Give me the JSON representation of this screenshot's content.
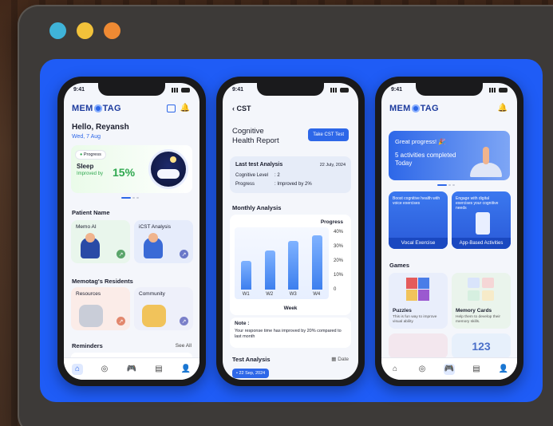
{
  "window": {
    "dots": [
      "#3fb3d8",
      "#f2c23a",
      "#ef8a33"
    ]
  },
  "phone1": {
    "time": "9:41",
    "logo_left": "MEM",
    "logo_right": "TAG",
    "greeting": "Hello, Reyansh",
    "date": "Wed, 7 Aug",
    "progress_tag": "Progress",
    "sleep_title": "Sleep",
    "sleep_sub": "Improved by",
    "sleep_value": "15%",
    "patient_section": "Patient Name",
    "card_memo": "Memo AI",
    "card_icst": "iCST Analysis",
    "residents_section": "Memotag's Residents",
    "card_resources": "Resources",
    "card_community": "Community",
    "reminders_section": "Reminders",
    "see_all": "See All"
  },
  "phone2": {
    "time": "9:41",
    "back_title": "CST",
    "report_title_1": "Cognitive",
    "report_title_2": "Health Report",
    "take_btn": "Take CST Test",
    "last_title": "Last test Analysis",
    "last_date": "22 July, 2024",
    "cog_label": "Cognitive Level",
    "cog_value": ": 2",
    "prog_label": "Progress",
    "prog_value": ": Improved by 2%",
    "monthly": "Monthly Analysis",
    "note_title": "Note :",
    "note_text": "Your response time has improved by 20% compared to last month",
    "test_analysis": "Test Analysis",
    "date_label": "Date",
    "chip_date": "22 Sep, 2024"
  },
  "chart_data": {
    "type": "bar",
    "categories": [
      "W1",
      "W2",
      "W3",
      "W4"
    ],
    "values": [
      20,
      27,
      34,
      38
    ],
    "title": "",
    "xlabel": "Week",
    "ylabel": "Progress",
    "ylim": [
      0,
      40
    ],
    "yticks": [
      "0",
      "10%",
      "20%",
      "30%",
      "40%"
    ],
    "grid": false
  },
  "phone3": {
    "time": "9:41",
    "logo_left": "MEM",
    "logo_right": "TAG",
    "banner_title": "Great progress!",
    "banner_sub": "5 activities completed Today",
    "vocal_desc": "Boost cognitive health with voice exercises",
    "vocal_label": "Vocal Exercise",
    "app_desc": "Engage with digital exercises your cognitive needs",
    "app_label": "App-Based Activities",
    "games_section": "Games",
    "puzzles_title": "Puzzles",
    "puzzles_desc": "This is fun way to improve visual ability",
    "memory_title": "Memory Cards",
    "memory_desc": "Help them to develop their memory skills.",
    "numbers_glyph": "123"
  }
}
